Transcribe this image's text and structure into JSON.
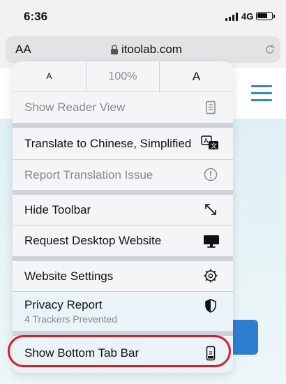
{
  "status_bar": {
    "time": "6:36",
    "network": "4G"
  },
  "url_bar": {
    "aa_label": "AA",
    "url": "itoolab.com"
  },
  "font_controls": {
    "smaller": "A",
    "zoom": "100%",
    "larger": "A"
  },
  "menu": {
    "reader_view": "Show Reader View",
    "translate": "Translate to Chinese, Simplified",
    "report_translation": "Report Translation Issue",
    "hide_toolbar": "Hide Toolbar",
    "request_desktop": "Request Desktop Website",
    "website_settings": "Website Settings",
    "privacy_report": "Privacy Report",
    "trackers_prevented": "4 Trackers Prevented",
    "show_bottom_tab_bar": "Show Bottom Tab Bar"
  },
  "colors": {
    "accent": "#3a86c8",
    "highlight": "#d0232c"
  }
}
